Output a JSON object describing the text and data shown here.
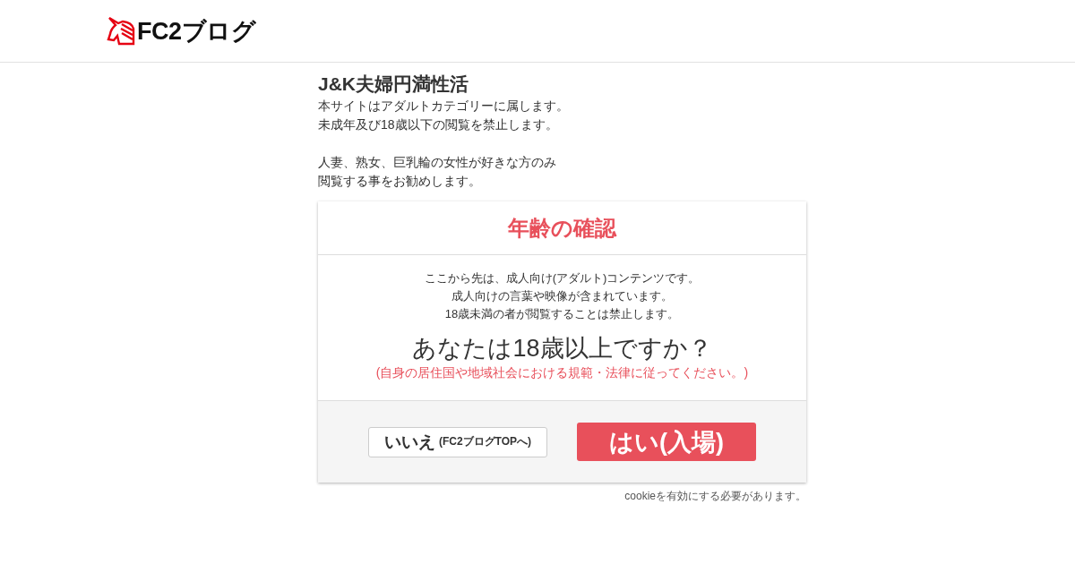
{
  "header": {
    "logo_text": "FC2ブログ"
  },
  "blog": {
    "title": "J&K夫婦円満性活",
    "paragraphs": [
      [
        "本サイトはアダルトカテゴリーに属します。",
        "未成年及び18歳以下の閲覧を禁止します。"
      ],
      [
        "人妻、熟女、巨乳輪の女性が好きな方のみ",
        "閲覧する事をお勧めします。"
      ]
    ]
  },
  "dialog": {
    "title": "年齢の確認",
    "lines": [
      "ここから先は、成人向け(アダルト)コンテンツです。",
      "成人向けの言葉や映像が含まれています。",
      "18歳未満の者が閲覧することは禁止します。"
    ],
    "question": "あなたは18歳以上ですか？",
    "note": "(自身の居住国や地域社会における規範・法律に従ってください。)",
    "no_button": {
      "label": "いいえ",
      "sub_label": "(FC2ブログTOPへ)"
    },
    "yes_button": {
      "label": "はい(入場)"
    }
  },
  "cookie_note": "cookieを有効にする必要があります。"
}
